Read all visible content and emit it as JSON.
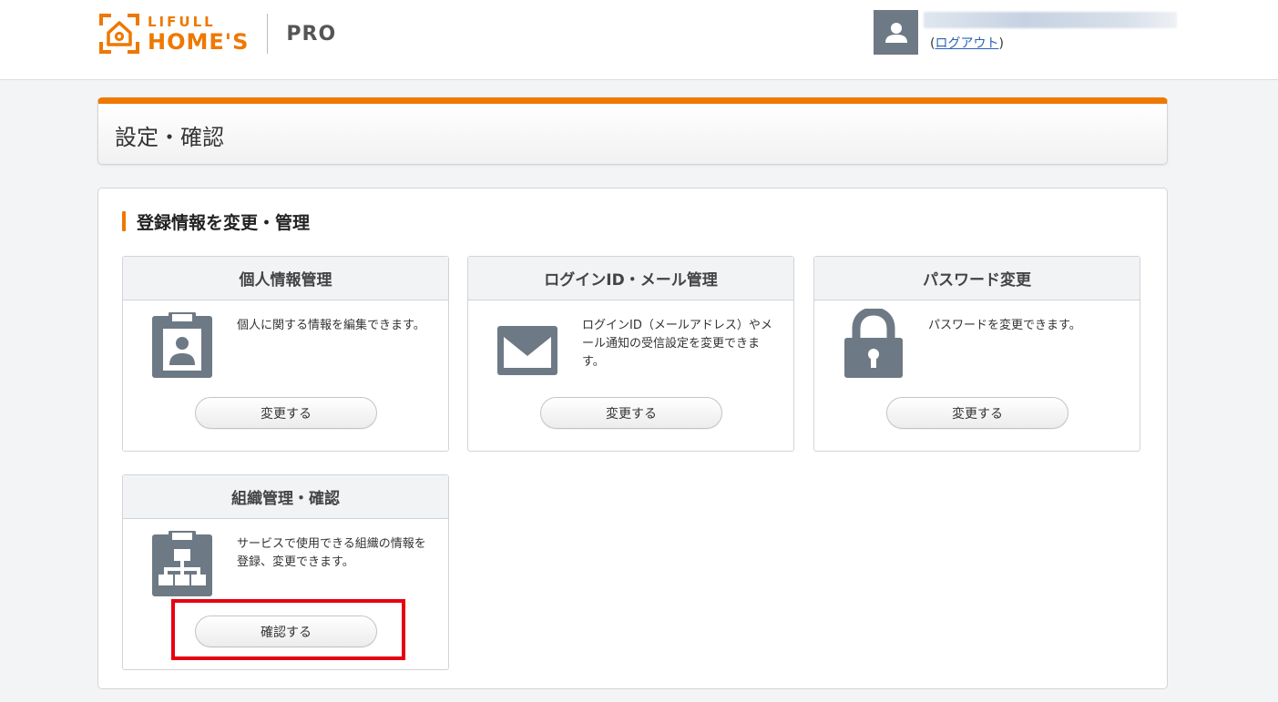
{
  "header": {
    "logo_line1": "LIFULL",
    "logo_line2": "HOME'S",
    "logo_pro": "PRO",
    "logout_prefix": "(",
    "logout_link": "ログアウト",
    "logout_suffix": ")"
  },
  "page": {
    "title": "設定・確認",
    "section_title": "登録情報を変更・管理"
  },
  "cards": [
    {
      "title": "個人情報管理",
      "icon": "id-badge-icon",
      "desc": "個人に関する情報を編集できます。",
      "button": "変更する"
    },
    {
      "title": "ログインID・メール管理",
      "icon": "envelope-icon",
      "desc": "ログインID（メールアドレス）やメール通知の受信設定を変更できます。",
      "button": "変更する"
    },
    {
      "title": "パスワード変更",
      "icon": "lock-icon",
      "desc": "パスワードを変更できます。",
      "button": "変更する"
    },
    {
      "title": "組織管理・確認",
      "icon": "org-chart-icon",
      "desc": "サービスで使用できる組織の情報を登録、変更できます。",
      "button": "確認する"
    }
  ],
  "colors": {
    "accent": "#ee7800",
    "icon_gray": "#6d7a85",
    "highlight": "#e60012",
    "link": "#2a63b8"
  }
}
